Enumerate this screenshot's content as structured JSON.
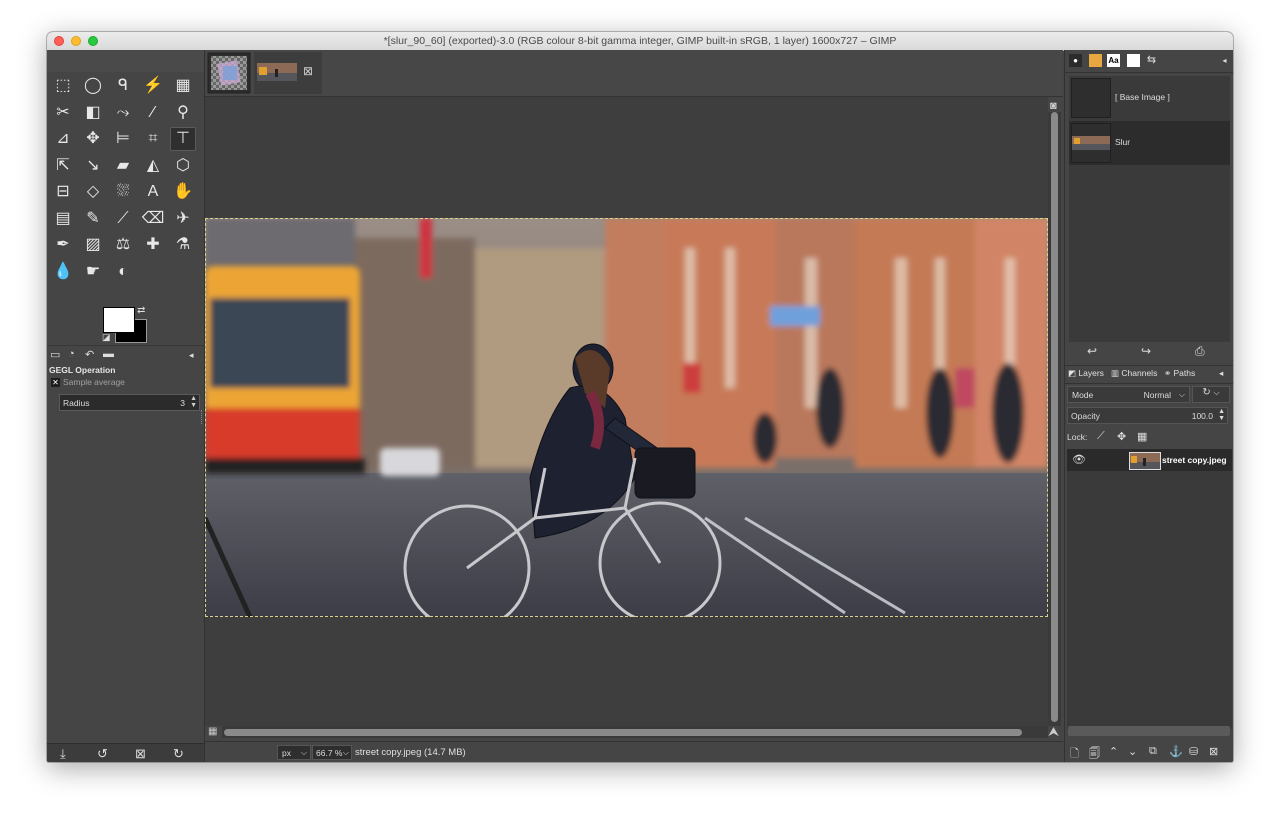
{
  "window": {
    "title": "*[slur_90_60] (exported)-3.0 (RGB colour 8-bit gamma integer, GIMP built-in sRGB, 1 layer) 1600x727 – GIMP"
  },
  "tools": [
    {
      "name": "rect-select-tool-icon",
      "glyph": "⬚"
    },
    {
      "name": "ellipse-select-tool-icon",
      "glyph": "◯"
    },
    {
      "name": "free-select-tool-icon",
      "glyph": "ᑫ"
    },
    {
      "name": "fuzzy-select-tool-icon",
      "glyph": "⚡"
    },
    {
      "name": "color-select-tool-icon",
      "glyph": "▦"
    },
    {
      "name": "scissors-select-tool-icon",
      "glyph": "✂"
    },
    {
      "name": "foreground-select-tool-icon",
      "glyph": "◧"
    },
    {
      "name": "paths-tool-icon",
      "glyph": "⤳"
    },
    {
      "name": "color-picker-tool-icon",
      "glyph": "⁄"
    },
    {
      "name": "zoom-tool-icon",
      "glyph": "⚲"
    },
    {
      "name": "measure-tool-icon",
      "glyph": "⊿"
    },
    {
      "name": "move-tool-icon",
      "glyph": "✥"
    },
    {
      "name": "align-tool-icon",
      "glyph": "⊨"
    },
    {
      "name": "crop-tool-icon",
      "glyph": "⌗"
    },
    {
      "name": "warp-transform-tool-icon",
      "glyph": "⊤"
    },
    {
      "name": "unified-transform-tool-icon",
      "glyph": "⇱"
    },
    {
      "name": "rotate-tool-icon",
      "glyph": "↘"
    },
    {
      "name": "shear-tool-icon",
      "glyph": "▰"
    },
    {
      "name": "flip-tool-icon",
      "glyph": "◭"
    },
    {
      "name": "perspective-tool-icon",
      "glyph": "⬡"
    },
    {
      "name": "cage-transform-tool-icon",
      "glyph": "⊟"
    },
    {
      "name": "handle-transform-tool-icon",
      "glyph": "◇"
    },
    {
      "name": "bucket-fill-tool-icon",
      "glyph": "⛆"
    },
    {
      "name": "text-tool-icon",
      "glyph": "A"
    },
    {
      "name": "gradient-tool-icon",
      "glyph": "✋"
    },
    {
      "name": "blend-tool-icon",
      "glyph": "▤"
    },
    {
      "name": "pencil-tool-icon",
      "glyph": "✎"
    },
    {
      "name": "paintbrush-tool-icon",
      "glyph": "⟋"
    },
    {
      "name": "eraser-tool-icon",
      "glyph": "⌫"
    },
    {
      "name": "airbrush-tool-icon",
      "glyph": "✈"
    },
    {
      "name": "ink-tool-icon",
      "glyph": "✒"
    },
    {
      "name": "mypaint-brush-tool-icon",
      "glyph": "▨"
    },
    {
      "name": "clone-tool-icon",
      "glyph": "⚖"
    },
    {
      "name": "heal-tool-icon",
      "glyph": "✚"
    },
    {
      "name": "perspective-clone-tool-icon",
      "glyph": "⚗"
    },
    {
      "name": "blur-tool-icon",
      "glyph": "💧"
    },
    {
      "name": "smudge-tool-icon",
      "glyph": "☛"
    },
    {
      "name": "dodge-burn-tool-icon",
      "glyph": "◐"
    }
  ],
  "tool_options": {
    "title": "GEGL Operation",
    "sample_average": "Sample average",
    "radius_label": "Radius",
    "radius_value": "3"
  },
  "images": [
    {
      "name": "[ Base Image ]"
    },
    {
      "name": "Slur"
    }
  ],
  "layers_panel": {
    "tabs": [
      "Layers",
      "Channels",
      "Paths"
    ],
    "mode_label": "Mode",
    "mode_value": "Normal",
    "opacity_label": "Opacity",
    "opacity_value": "100.0",
    "lock_label": "Lock:",
    "layers": [
      {
        "name": "street copy.jpeg"
      }
    ]
  },
  "status": {
    "unit": "px",
    "zoom": "66.7 %",
    "file": "street copy.jpeg (14.7 MB)"
  }
}
